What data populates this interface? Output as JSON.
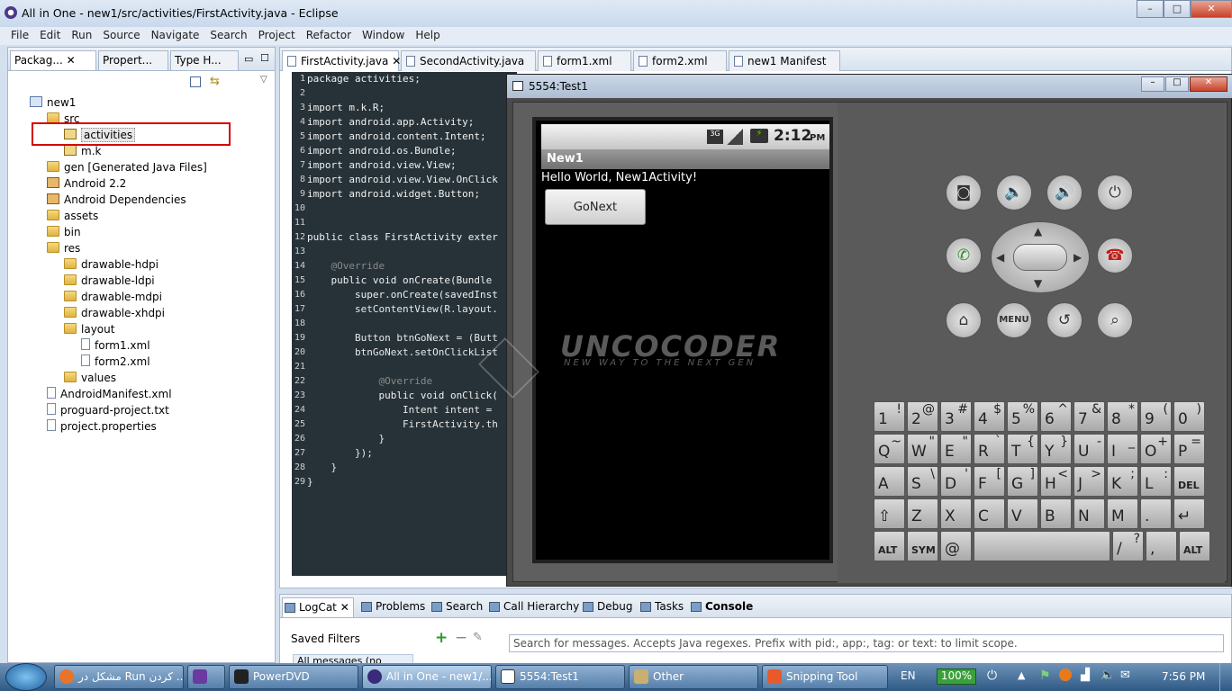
{
  "window": {
    "title": "All in One - new1/src/activities/FirstActivity.java - Eclipse"
  },
  "menu": [
    "File",
    "Edit",
    "Run",
    "Source",
    "Navigate",
    "Search",
    "Project",
    "Refactor",
    "Window",
    "Help"
  ],
  "left_tabs": [
    "Packag...",
    "Propert...",
    "Type H..."
  ],
  "tree": [
    {
      "label": "new1",
      "indent": 0,
      "icon": "proj"
    },
    {
      "label": "src",
      "indent": 1,
      "icon": "folder"
    },
    {
      "label": "activities",
      "indent": 2,
      "icon": "pkg"
    },
    {
      "label": "m.k",
      "indent": 2,
      "icon": "pkg"
    },
    {
      "label": "gen [Generated Java Files]",
      "indent": 1,
      "icon": "folder"
    },
    {
      "label": "Android 2.2",
      "indent": 1,
      "icon": "jar"
    },
    {
      "label": "Android Dependencies",
      "indent": 1,
      "icon": "jar"
    },
    {
      "label": "assets",
      "indent": 1,
      "icon": "folder"
    },
    {
      "label": "bin",
      "indent": 1,
      "icon": "folder"
    },
    {
      "label": "res",
      "indent": 1,
      "icon": "folder"
    },
    {
      "label": "drawable-hdpi",
      "indent": 2,
      "icon": "folder"
    },
    {
      "label": "drawable-ldpi",
      "indent": 2,
      "icon": "folder"
    },
    {
      "label": "drawable-mdpi",
      "indent": 2,
      "icon": "folder"
    },
    {
      "label": "drawable-xhdpi",
      "indent": 2,
      "icon": "folder"
    },
    {
      "label": "layout",
      "indent": 2,
      "icon": "folder"
    },
    {
      "label": "form1.xml",
      "indent": 3,
      "icon": "file"
    },
    {
      "label": "form2.xml",
      "indent": 3,
      "icon": "file"
    },
    {
      "label": "values",
      "indent": 2,
      "icon": "folder"
    },
    {
      "label": "AndroidManifest.xml",
      "indent": 1,
      "icon": "file"
    },
    {
      "label": "proguard-project.txt",
      "indent": 1,
      "icon": "file"
    },
    {
      "label": "project.properties",
      "indent": 1,
      "icon": "file"
    }
  ],
  "editor_tabs": [
    "FirstActivity.java",
    "SecondActivity.java",
    "form1.xml",
    "form2.xml",
    "new1 Manifest"
  ],
  "line_numbers": [
    "1",
    "2",
    "3",
    "4",
    "5",
    "6",
    "7",
    "8",
    "9",
    "10",
    "11",
    "12",
    "13",
    "14",
    "15",
    "16",
    "17",
    "18",
    "19",
    "20",
    "21",
    "22",
    "23",
    "24",
    "25",
    "26",
    "27",
    "28",
    "29"
  ],
  "code_lines": [
    "package activities;",
    "",
    "import m.k.R;",
    "import android.app.Activity;",
    "import android.content.Intent;",
    "import android.os.Bundle;",
    "import android.view.View;",
    "import android.view.View.OnClick",
    "import android.widget.Button;",
    "",
    "",
    "public class FirstActivity exter",
    "",
    "    @Override",
    "    public void onCreate(Bundle",
    "        super.onCreate(savedInst",
    "        setContentView(R.layout.",
    "",
    "        Button btnGoNext = (Butt",
    "        btnGoNext.setOnClickList",
    "",
    "            @Override",
    "            public void onClick(",
    "                Intent intent =",
    "                FirstActivity.th",
    "            }",
    "        });",
    "    }",
    "}"
  ],
  "emulator": {
    "title": "5554:Test1",
    "time": "2:12",
    "ampm": "PM",
    "app_title": "New1",
    "hello": "Hello World, New1Activity!",
    "button": "GoNext",
    "menu_label": "MENU"
  },
  "watermark": {
    "brand": "UNCOCODER",
    "tagline": "NEW WAY TO THE NEXT GEN"
  },
  "keyboard": [
    [
      "1",
      "!"
    ],
    [
      "2",
      "@"
    ],
    [
      "3",
      "#"
    ],
    [
      "4",
      "$"
    ],
    [
      "5",
      "%"
    ],
    [
      "6",
      "^"
    ],
    [
      "7",
      "&"
    ],
    [
      "8",
      "*"
    ],
    [
      "9",
      "("
    ],
    [
      "0",
      ")"
    ],
    [
      "Q",
      "~"
    ],
    [
      "W",
      "\""
    ],
    [
      "E",
      "\""
    ],
    [
      "R",
      "`"
    ],
    [
      "T",
      "{"
    ],
    [
      "Y",
      "}"
    ],
    [
      "U",
      "-"
    ],
    [
      "I",
      "_"
    ],
    [
      "O",
      "+"
    ],
    [
      "P",
      "="
    ],
    [
      "A",
      ""
    ],
    [
      "S",
      "\\"
    ],
    [
      "D",
      "'"
    ],
    [
      "F",
      "["
    ],
    [
      "G",
      "]"
    ],
    [
      "H",
      "<"
    ],
    [
      "J",
      ">"
    ],
    [
      "K",
      ";"
    ],
    [
      "L",
      ":"
    ],
    [
      "DEL",
      ""
    ],
    [
      "⇧",
      ""
    ],
    [
      "Z",
      ""
    ],
    [
      "X",
      ""
    ],
    [
      "C",
      ""
    ],
    [
      "V",
      ""
    ],
    [
      "B",
      ""
    ],
    [
      "N",
      ""
    ],
    [
      "M",
      ""
    ],
    [
      ".",
      ""
    ],
    [
      "↵",
      ""
    ],
    [
      "ALT",
      ""
    ],
    [
      "SYM",
      ""
    ],
    [
      "@",
      ""
    ],
    [
      "",
      ""
    ],
    [
      "/",
      "?"
    ],
    [
      ",",
      ""
    ],
    [
      "ALT",
      ""
    ]
  ],
  "bottom_tabs": [
    "LogCat",
    "Problems",
    "Search",
    "Call Hierarchy",
    "Debug",
    "Tasks",
    "Console"
  ],
  "logcat": {
    "saved_filters": "Saved Filters",
    "filter_item": "All messages (no filters)",
    "search_placeholder": "Search for messages. Accepts Java regexes. Prefix with pid:, app:, tag: or text: to limit scope."
  },
  "taskbar": {
    "items": [
      "مشکل در Run کردن ...",
      "",
      "PowerDVD",
      "All in One - new1/...",
      "5554:Test1",
      "Other",
      "Snipping Tool"
    ],
    "lang": "EN",
    "battery": "100%",
    "clock": "7:56 PM"
  }
}
